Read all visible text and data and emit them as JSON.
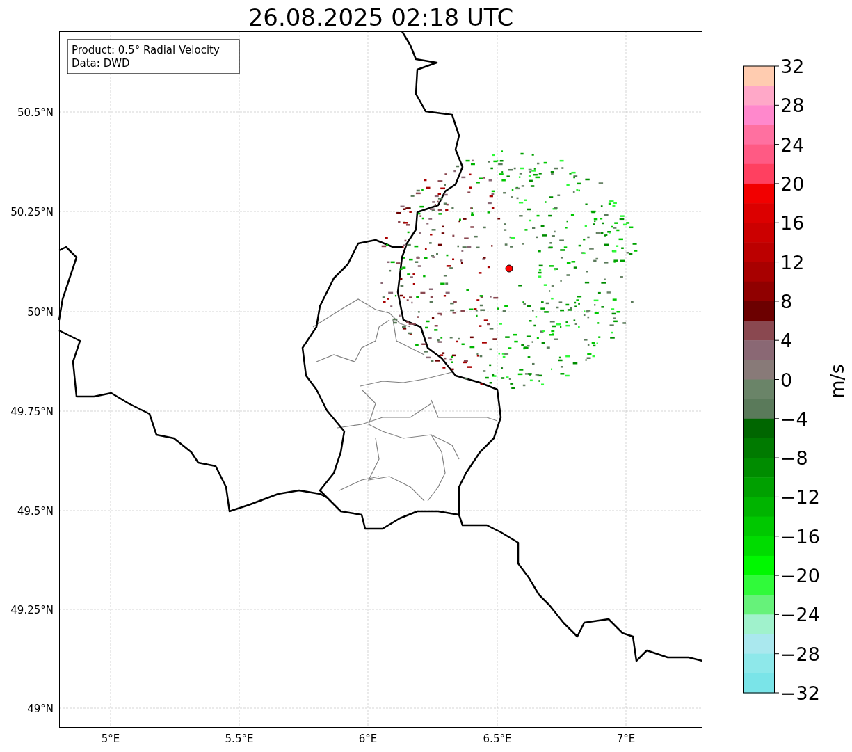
{
  "title": "26.08.2025 02:18 UTC",
  "annotation": [
    "Product: 0.5° Radial Velocity",
    "Data: DWD"
  ],
  "map": {
    "xticks": [
      "5°E",
      "5.5°E",
      "6°E",
      "6.5°E",
      "7°E"
    ],
    "yticks": [
      "50.5°N",
      "50.25°N",
      "50°N",
      "49.75°N",
      "49.5°N",
      "49.25°N",
      "49°N"
    ]
  },
  "colorbar": {
    "label": "m/s",
    "ticks": [
      "32",
      "28",
      "24",
      "20",
      "16",
      "12",
      "8",
      "4",
      "0",
      "−4",
      "−8",
      "−12",
      "−16",
      "−20",
      "−24",
      "−28",
      "−32"
    ],
    "bins": [
      {
        "color": "#ffccb0"
      },
      {
        "color": "#ffa8c8"
      },
      {
        "color": "#ff88cc"
      },
      {
        "color": "#ff70a0"
      },
      {
        "color": "#ff5a84"
      },
      {
        "color": "#ff4060"
      },
      {
        "color": "#f20000"
      },
      {
        "color": "#dc0000"
      },
      {
        "color": "#cc0000"
      },
      {
        "color": "#bc0000"
      },
      {
        "color": "#a80000"
      },
      {
        "color": "#900000"
      },
      {
        "color": "#6c0000"
      },
      {
        "color": "#8a4850"
      },
      {
        "color": "#8a6874"
      },
      {
        "color": "#887a78"
      },
      {
        "color": "#6a8468"
      },
      {
        "color": "#5a7a5a"
      },
      {
        "color": "#006600"
      },
      {
        "color": "#007a00"
      },
      {
        "color": "#008c00"
      },
      {
        "color": "#00a000"
      },
      {
        "color": "#00b400"
      },
      {
        "color": "#00c800"
      },
      {
        "color": "#00dc00"
      },
      {
        "color": "#00f800"
      },
      {
        "color": "#30fa3a"
      },
      {
        "color": "#66f27a"
      },
      {
        "color": "#a0f2cc"
      },
      {
        "color": "#aae8ee"
      },
      {
        "color": "#8ee8ea"
      },
      {
        "color": "#7ae4e8"
      }
    ]
  }
}
